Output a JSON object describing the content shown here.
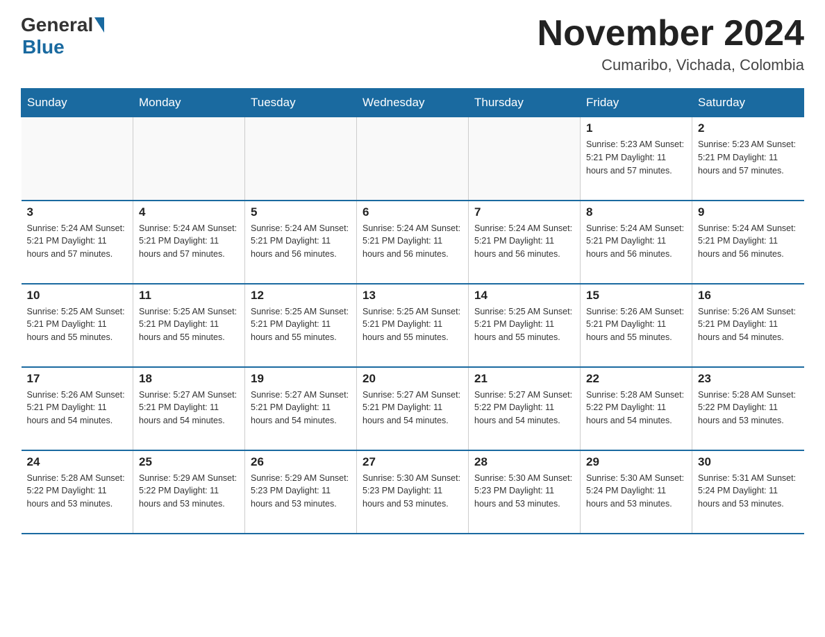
{
  "logo": {
    "general": "General",
    "blue": "Blue"
  },
  "title": "November 2024",
  "location": "Cumaribo, Vichada, Colombia",
  "days_of_week": [
    "Sunday",
    "Monday",
    "Tuesday",
    "Wednesday",
    "Thursday",
    "Friday",
    "Saturday"
  ],
  "weeks": [
    [
      {
        "day": "",
        "info": ""
      },
      {
        "day": "",
        "info": ""
      },
      {
        "day": "",
        "info": ""
      },
      {
        "day": "",
        "info": ""
      },
      {
        "day": "",
        "info": ""
      },
      {
        "day": "1",
        "info": "Sunrise: 5:23 AM\nSunset: 5:21 PM\nDaylight: 11 hours and 57 minutes."
      },
      {
        "day": "2",
        "info": "Sunrise: 5:23 AM\nSunset: 5:21 PM\nDaylight: 11 hours and 57 minutes."
      }
    ],
    [
      {
        "day": "3",
        "info": "Sunrise: 5:24 AM\nSunset: 5:21 PM\nDaylight: 11 hours and 57 minutes."
      },
      {
        "day": "4",
        "info": "Sunrise: 5:24 AM\nSunset: 5:21 PM\nDaylight: 11 hours and 57 minutes."
      },
      {
        "day": "5",
        "info": "Sunrise: 5:24 AM\nSunset: 5:21 PM\nDaylight: 11 hours and 56 minutes."
      },
      {
        "day": "6",
        "info": "Sunrise: 5:24 AM\nSunset: 5:21 PM\nDaylight: 11 hours and 56 minutes."
      },
      {
        "day": "7",
        "info": "Sunrise: 5:24 AM\nSunset: 5:21 PM\nDaylight: 11 hours and 56 minutes."
      },
      {
        "day": "8",
        "info": "Sunrise: 5:24 AM\nSunset: 5:21 PM\nDaylight: 11 hours and 56 minutes."
      },
      {
        "day": "9",
        "info": "Sunrise: 5:24 AM\nSunset: 5:21 PM\nDaylight: 11 hours and 56 minutes."
      }
    ],
    [
      {
        "day": "10",
        "info": "Sunrise: 5:25 AM\nSunset: 5:21 PM\nDaylight: 11 hours and 55 minutes."
      },
      {
        "day": "11",
        "info": "Sunrise: 5:25 AM\nSunset: 5:21 PM\nDaylight: 11 hours and 55 minutes."
      },
      {
        "day": "12",
        "info": "Sunrise: 5:25 AM\nSunset: 5:21 PM\nDaylight: 11 hours and 55 minutes."
      },
      {
        "day": "13",
        "info": "Sunrise: 5:25 AM\nSunset: 5:21 PM\nDaylight: 11 hours and 55 minutes."
      },
      {
        "day": "14",
        "info": "Sunrise: 5:25 AM\nSunset: 5:21 PM\nDaylight: 11 hours and 55 minutes."
      },
      {
        "day": "15",
        "info": "Sunrise: 5:26 AM\nSunset: 5:21 PM\nDaylight: 11 hours and 55 minutes."
      },
      {
        "day": "16",
        "info": "Sunrise: 5:26 AM\nSunset: 5:21 PM\nDaylight: 11 hours and 54 minutes."
      }
    ],
    [
      {
        "day": "17",
        "info": "Sunrise: 5:26 AM\nSunset: 5:21 PM\nDaylight: 11 hours and 54 minutes."
      },
      {
        "day": "18",
        "info": "Sunrise: 5:27 AM\nSunset: 5:21 PM\nDaylight: 11 hours and 54 minutes."
      },
      {
        "day": "19",
        "info": "Sunrise: 5:27 AM\nSunset: 5:21 PM\nDaylight: 11 hours and 54 minutes."
      },
      {
        "day": "20",
        "info": "Sunrise: 5:27 AM\nSunset: 5:21 PM\nDaylight: 11 hours and 54 minutes."
      },
      {
        "day": "21",
        "info": "Sunrise: 5:27 AM\nSunset: 5:22 PM\nDaylight: 11 hours and 54 minutes."
      },
      {
        "day": "22",
        "info": "Sunrise: 5:28 AM\nSunset: 5:22 PM\nDaylight: 11 hours and 54 minutes."
      },
      {
        "day": "23",
        "info": "Sunrise: 5:28 AM\nSunset: 5:22 PM\nDaylight: 11 hours and 53 minutes."
      }
    ],
    [
      {
        "day": "24",
        "info": "Sunrise: 5:28 AM\nSunset: 5:22 PM\nDaylight: 11 hours and 53 minutes."
      },
      {
        "day": "25",
        "info": "Sunrise: 5:29 AM\nSunset: 5:22 PM\nDaylight: 11 hours and 53 minutes."
      },
      {
        "day": "26",
        "info": "Sunrise: 5:29 AM\nSunset: 5:23 PM\nDaylight: 11 hours and 53 minutes."
      },
      {
        "day": "27",
        "info": "Sunrise: 5:30 AM\nSunset: 5:23 PM\nDaylight: 11 hours and 53 minutes."
      },
      {
        "day": "28",
        "info": "Sunrise: 5:30 AM\nSunset: 5:23 PM\nDaylight: 11 hours and 53 minutes."
      },
      {
        "day": "29",
        "info": "Sunrise: 5:30 AM\nSunset: 5:24 PM\nDaylight: 11 hours and 53 minutes."
      },
      {
        "day": "30",
        "info": "Sunrise: 5:31 AM\nSunset: 5:24 PM\nDaylight: 11 hours and 53 minutes."
      }
    ]
  ]
}
